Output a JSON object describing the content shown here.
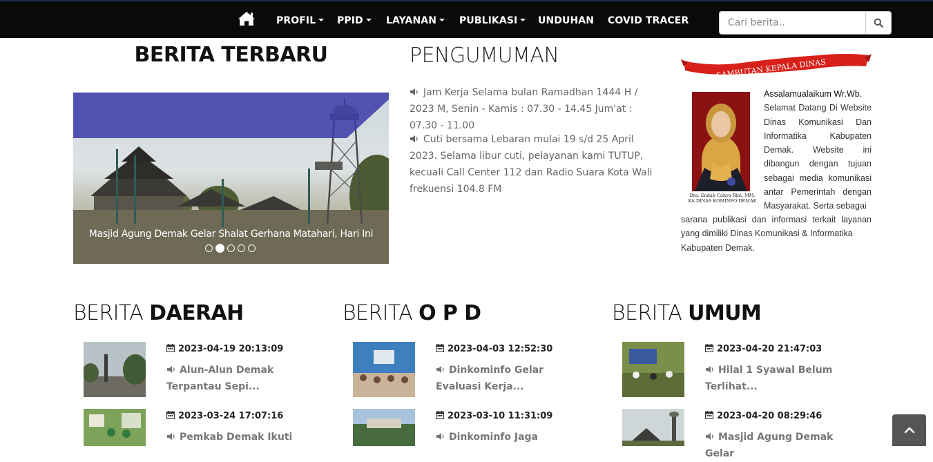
{
  "nav": {
    "home_icon": "home-icon",
    "items": [
      {
        "label": "PROFIL",
        "dropdown": true
      },
      {
        "label": "PPID",
        "dropdown": true
      },
      {
        "label": "LAYANAN",
        "dropdown": true
      },
      {
        "label": "PUBLIKASI",
        "dropdown": true
      },
      {
        "label": "UNDUHAN",
        "dropdown": false
      },
      {
        "label": "COVID TRACER",
        "dropdown": false
      }
    ],
    "search_placeholder": "Cari berita..",
    "search_icon": "search-icon"
  },
  "headings": {
    "berita_terbaru": "BERITA TERBARU",
    "pengumuman": "PENGUMUMAN"
  },
  "slider": {
    "caption": "Masjid Agung Demak Gelar Shalat Gerhana Matahari, Hari Ini",
    "slide_count": 5,
    "active_slide": 2
  },
  "pengumuman": [
    "Jam Kerja Selama bulan Ramadhan 1444 H / 2023 M, Senin - Kamis : 07.30 - 14.45 Jum'at : 07.30 - 11.00",
    "Cuti bersama Lebaran mulai 19 s/d 25 April 2023. Selama libur cuti, pelayanan kami TUTUP, kecuali Call Center 112 dan Radio Suara Kota Wali frekuensi 104.8 FM"
  ],
  "sambutan": {
    "banner": "SAMBUTAN KEPALA DINAS",
    "photo_caption_1": "Dra. Endah Cahya Rini, MM.",
    "photo_caption_2": "KA.DINAS KOMINFO DEMAK",
    "greeting": "Assalamualaikum Wr.Wb.",
    "text_right": "Selamat Datang Di Website Dinas Komunikasi Dan Informatika Kabupaten Demak. Website ini dibangun dengan tujuan sebagai media komunikasi antar Pemerintah dengan Masyarakat. Serta sebagai",
    "text_bottom_1": "sarana publikasi dan informasi terkait layanan yang dimiliki Dinas Komunikasi & Informatika",
    "text_bottom_2": "Kabupaten Demak."
  },
  "columns": [
    {
      "head_light": "BERITA ",
      "head_bold": "DAERAH",
      "items": [
        {
          "date": "2023-04-19 20:13:09",
          "title": "Alun-Alun Demak Terpantau Sepi..."
        },
        {
          "date": "2023-03-24 17:07:16",
          "title": "Pemkab Demak Ikuti"
        }
      ]
    },
    {
      "head_light": "BERITA ",
      "head_bold": "O P D",
      "items": [
        {
          "date": "2023-04-03 12:52:30",
          "title": "Dinkominfo Gelar Evaluasi Kerja..."
        },
        {
          "date": "2023-03-10 11:31:09",
          "title": "Dinkominfo Jaga"
        }
      ]
    },
    {
      "head_light": "BERITA ",
      "head_bold": "UMUM",
      "items": [
        {
          "date": "2023-04-20 21:47:03",
          "title": "Hilal 1 Syawal Belum Terlihat..."
        },
        {
          "date": "2023-04-20 08:29:46",
          "title": "Masjid Agung Demak Gelar"
        }
      ]
    }
  ],
  "colors": {
    "navbar": "#0a0a0a",
    "caption_band": "#3b3aa8",
    "banner_red": "#d8201a",
    "text_gray": "#777777"
  },
  "icons": {
    "speaker": "volume-icon",
    "calendar": "calendar-icon",
    "back_to_top": "chevron-up-icon"
  }
}
